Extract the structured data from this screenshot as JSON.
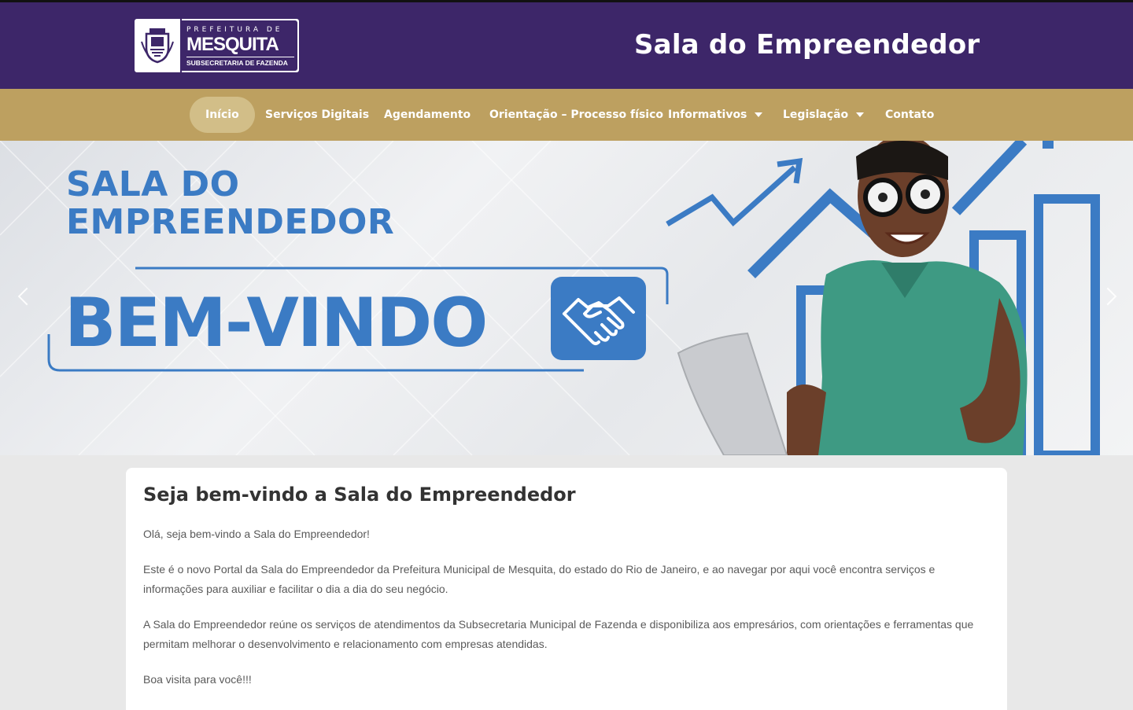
{
  "header": {
    "logo": {
      "prefeitura": "PREFEITURA DE",
      "city": "MESQUITA",
      "subtitle": "SUBSECRETARIA DE FAZENDA"
    },
    "title": "Sala do Empreendedor"
  },
  "nav": {
    "items": [
      {
        "label": "Início",
        "active": true
      },
      {
        "label": "Serviços Digitais"
      },
      {
        "label": "Agendamento"
      },
      {
        "label": "Orientação – Processo físico"
      },
      {
        "label": "Informativos",
        "dropdown": true
      },
      {
        "label": "Legislação",
        "dropdown": true
      },
      {
        "label": "Contato"
      }
    ]
  },
  "hero": {
    "line1": "SALA DO",
    "line2": "EMPREENDEDOR",
    "welcome": "BEM-VINDO",
    "icon": "handshake-icon"
  },
  "content": {
    "title": "Seja bem-vindo a Sala do Empreendedor",
    "paragraphs": [
      "Olá, seja bem-vindo a Sala do Empreendedor!",
      "Este é o novo Portal da Sala do Empreendedor da Prefeitura Municipal de Mesquita, do estado do Rio de Janeiro, e ao navegar por aqui você encontra serviços e informações para auxiliar e facilitar o dia a dia do seu negócio.",
      "A Sala do Empreendedor reúne os serviços de atendimentos da Subsecretaria Municipal de Fazenda e disponibiliza aos empresários, com orientações e ferramentas que permitam melhorar o desenvolvimento e relacionamento com empresas atendidas.",
      "Boa visita para você!!!"
    ]
  },
  "colors": {
    "header_bg": "#3d2669",
    "nav_bg": "#bda060",
    "nav_active_bg": "#d2be88",
    "hero_blue": "#3b7bc4"
  }
}
